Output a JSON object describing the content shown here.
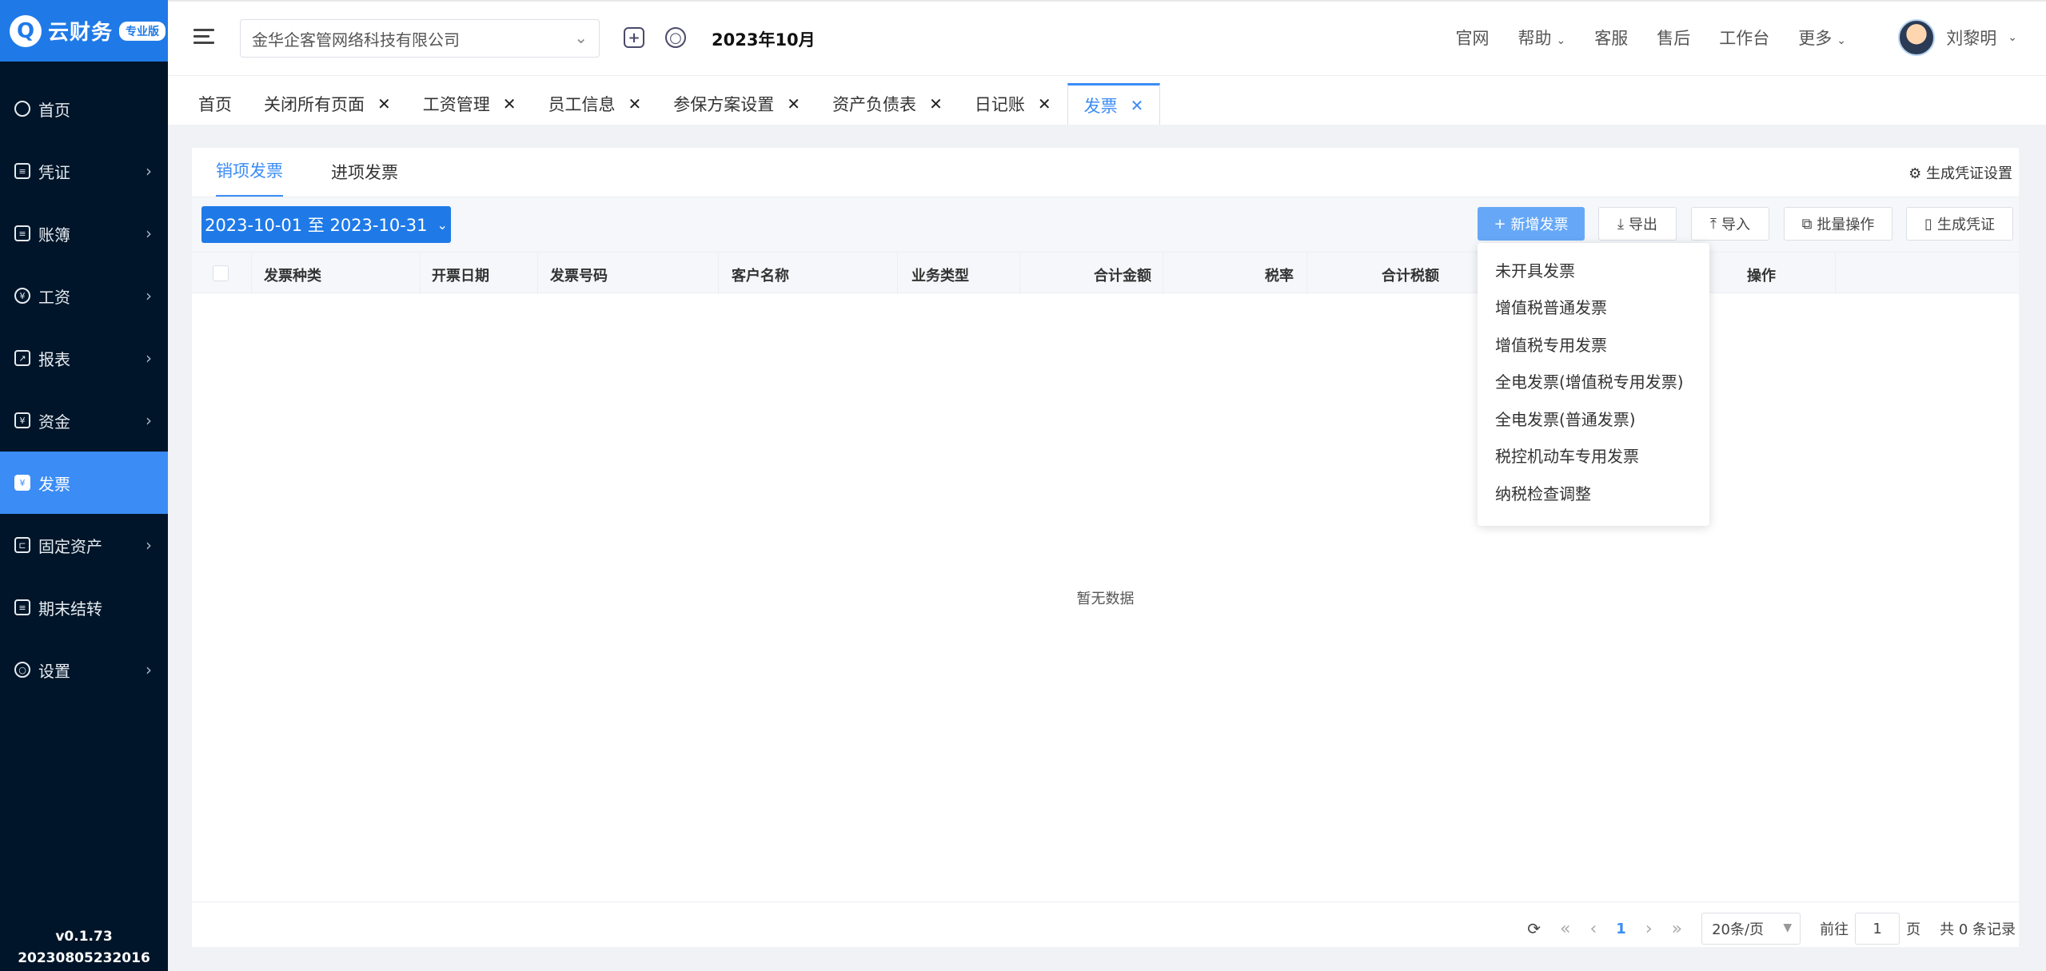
{
  "sidebar": {
    "logo_mark": "Q",
    "logo_text": "云财务",
    "logo_badge": "专业版",
    "items": [
      {
        "label": "首页",
        "icon": "home-icon",
        "chevron": false,
        "active": false
      },
      {
        "label": "凭证",
        "icon": "voucher-icon",
        "chevron": true,
        "active": false
      },
      {
        "label": "账簿",
        "icon": "ledger-icon",
        "chevron": true,
        "active": false
      },
      {
        "label": "工资",
        "icon": "salary-icon",
        "chevron": true,
        "active": false
      },
      {
        "label": "报表",
        "icon": "report-icon",
        "chevron": true,
        "active": false
      },
      {
        "label": "资金",
        "icon": "funds-icon",
        "chevron": true,
        "active": false
      },
      {
        "label": "发票",
        "icon": "invoice-icon",
        "chevron": false,
        "active": true
      },
      {
        "label": "固定资产",
        "icon": "fixed-assets-icon",
        "chevron": true,
        "active": false
      },
      {
        "label": "期末结转",
        "icon": "period-close-icon",
        "chevron": false,
        "active": false
      },
      {
        "label": "设置",
        "icon": "settings-icon",
        "chevron": true,
        "active": false
      }
    ],
    "version": "v0.1.73",
    "build": "20230805232016"
  },
  "header": {
    "company": "金华企客管网络科技有限公司",
    "period": "2023年10月",
    "links": [
      "官网",
      "帮助",
      "客服",
      "售后",
      "工作台",
      "更多"
    ],
    "user_name": "刘黎明"
  },
  "tabs": [
    {
      "label": "首页",
      "closable": false
    },
    {
      "label": "关闭所有页面",
      "closable": true
    },
    {
      "label": "工资管理",
      "closable": true
    },
    {
      "label": "员工信息",
      "closable": true
    },
    {
      "label": "参保方案设置",
      "closable": true
    },
    {
      "label": "资产负债表",
      "closable": true
    },
    {
      "label": "日记账",
      "closable": true
    },
    {
      "label": "发票",
      "closable": true,
      "active": true
    }
  ],
  "subtabs": [
    "销项发票",
    "进项发票"
  ],
  "gen_settings": "生成凭证设置",
  "toolbar": {
    "date_range": "2023-10-01 至 2023-10-31",
    "new_invoice": "新增发票",
    "export": "导出",
    "import": "导入",
    "batch": "批量操作",
    "gen_voucher": "生成凭证"
  },
  "table": {
    "columns": [
      "发票种类",
      "开票日期",
      "发票号码",
      "客户名称",
      "业务类型",
      "合计金额",
      "税率",
      "合计税额",
      "操作"
    ],
    "empty_text": "暂无数据"
  },
  "dropdown_items": [
    "未开具发票",
    "增值税普通发票",
    "增值税专用发票",
    "全电发票(增值税专用发票)",
    "全电发票(普通发票)",
    "税控机动车专用发票",
    "纳税检查调整"
  ],
  "pager": {
    "current_page": "1",
    "page_size": "20条/页",
    "goto_label": "前往",
    "goto_value": "1",
    "page_unit": "页",
    "total": "共 0 条记录"
  },
  "colors": {
    "primary": "#1f7ae8",
    "sidebar_bg": "#001529",
    "active_nav": "#3b8cf5"
  }
}
